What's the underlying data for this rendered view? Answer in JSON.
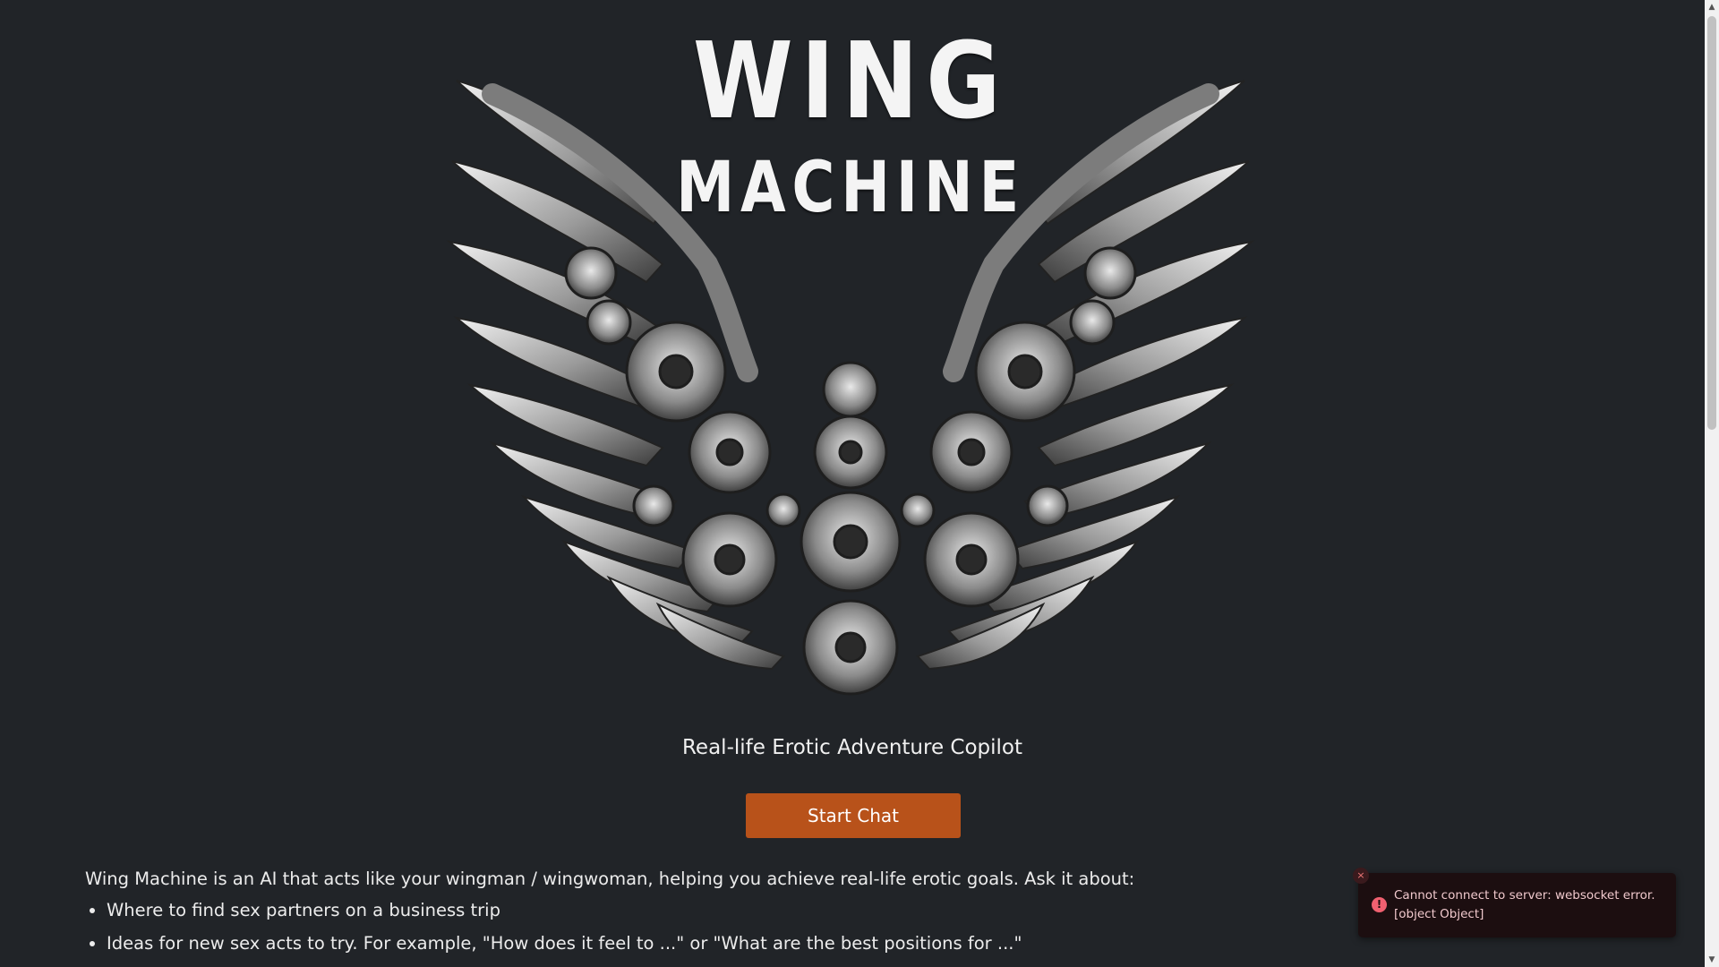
{
  "logo": {
    "line1": "WING",
    "line2": "MACHINE"
  },
  "tagline": "Real-life Erotic Adventure Copilot",
  "start_button": "Start Chat",
  "intro": "Wing Machine is an AI that acts like your wingman / wingwoman, helping you achieve real-life erotic goals. Ask it about:",
  "bullets": [
    "Where to find sex partners on a business trip",
    "Ideas for new sex acts to try. For example, \"How does it feel to ...\" or \"What are the best positions for ...\""
  ],
  "toast": {
    "close_glyph": "×",
    "icon_glyph": "!",
    "message": "Cannot connect to server: websocket error. [object Object]"
  },
  "colors": {
    "background": "#212428",
    "button": "#b8521a",
    "toast_bg": "#1c0e10",
    "toast_icon": "#f06070"
  }
}
